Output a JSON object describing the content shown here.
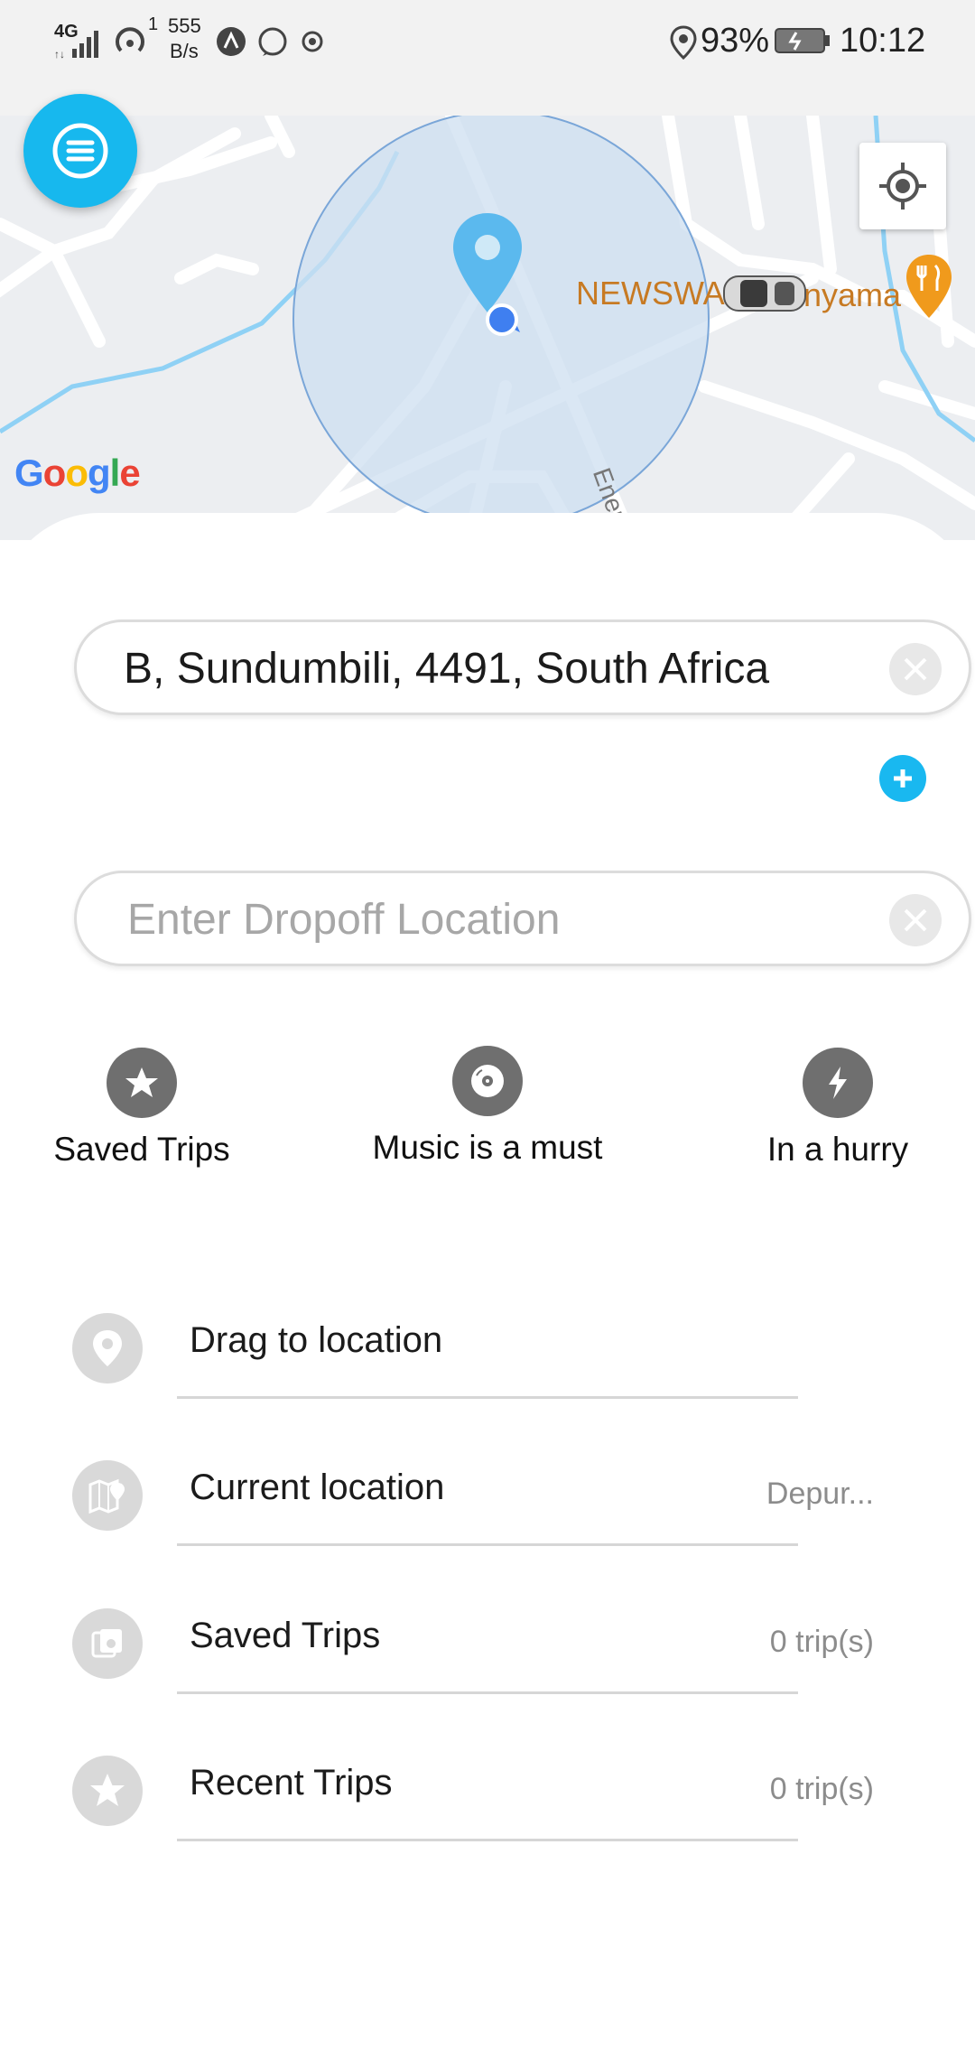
{
  "status_bar": {
    "network": "4G",
    "hotspot_count": "1",
    "speed_value": "555",
    "speed_unit": "B/s",
    "battery": "93%",
    "time": "10:12"
  },
  "map": {
    "poi_label_left": "NEWSWA",
    "poi_label_right": "nyama",
    "road_label": "Ener",
    "google_logo": "Google",
    "colors": {
      "radius_fill": "#cddff0",
      "pin": "#5bb9ee",
      "dot": "#3f7ff0",
      "poi_text": "#c77a23",
      "poi_pin": "#f09a1c"
    }
  },
  "menu_button": {
    "icon": "menu-icon",
    "color": "#17b8ee"
  },
  "locate_button": {
    "icon": "crosshair-icon"
  },
  "pickup": {
    "value": "B, Sundumbili, 4491, South Africa",
    "placeholder": ""
  },
  "add_stop_button": {
    "icon": "plus-icon",
    "color": "#19b8f0"
  },
  "dropoff": {
    "value": "",
    "placeholder": "Enter Dropoff Location"
  },
  "features": [
    {
      "label": "Saved Trips",
      "icon": "star-icon"
    },
    {
      "label": "Music is a must",
      "icon": "disc-icon"
    },
    {
      "label": "In a hurry",
      "icon": "lightning-icon"
    }
  ],
  "list": [
    {
      "title": "Drag to location",
      "meta": "",
      "icon": "pin-icon"
    },
    {
      "title": "Current location",
      "meta": "Depur...",
      "icon": "map-pin-icon"
    },
    {
      "title": "Saved Trips",
      "meta": "0 trip(s)",
      "icon": "saved-icon"
    },
    {
      "title": "Recent Trips",
      "meta": "0 trip(s)",
      "icon": "star-icon"
    }
  ]
}
